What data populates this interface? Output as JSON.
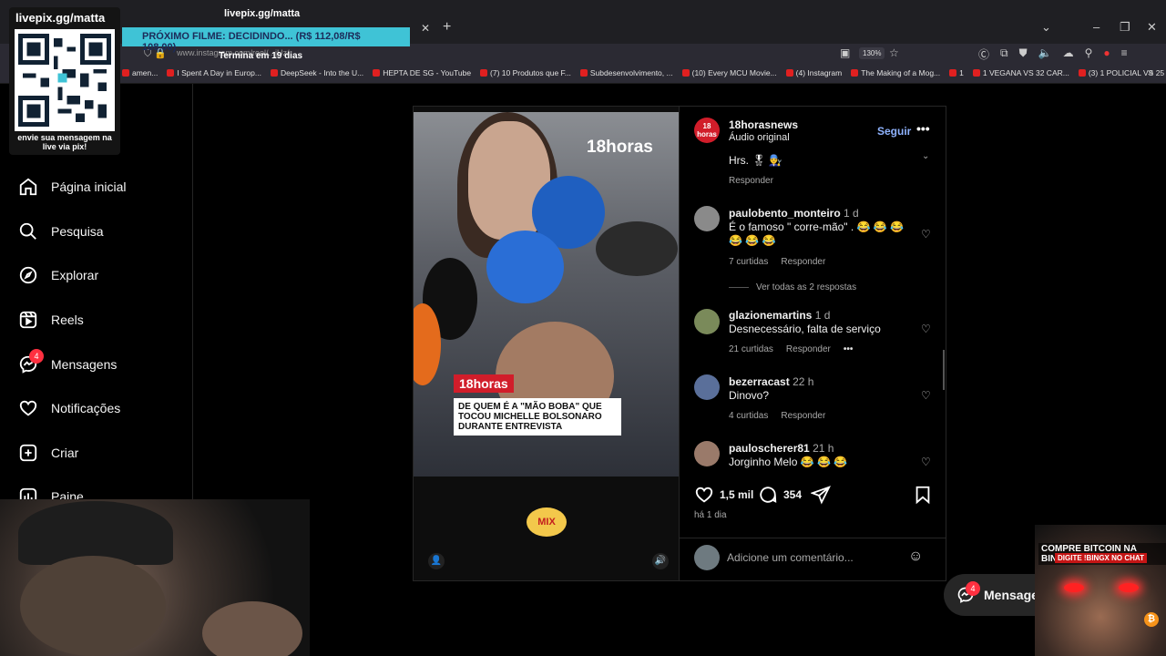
{
  "browser": {
    "tab_title": "Termina em 19 dias",
    "url": "www.instagram.com/reel/...jUz/",
    "zoom": "130%",
    "bookmarks": [
      "amen...",
      "I Spent A Day in Europ...",
      "DeepSeek - Into the U...",
      "HEPTA DE SG - YouTube",
      "(7) 10 Produtos que F...",
      "Subdesenvolvimento, ...",
      "(10) Every MCU Movie...",
      "(4) Instagram",
      "The Making of a Mog...",
      "1",
      "1 VEGANA VS 32 CAR...",
      "(3) 1 POLICIAL VS 25 E..."
    ]
  },
  "overlay": {
    "pix_handle": "livepix.gg/matta",
    "pix_handle_top": "livepix.gg/matta",
    "pix_caption": "envie sua mensagem na live via pix!",
    "banner": "PRÓXIMO FILME: DECIDINDO... (R$ 112,08/R$ 108,00)",
    "ad_line1": "COMPRE BITCOIN NA BINGX.",
    "ad_line2": "DIGITE !BINGX NO CHAT"
  },
  "sidebar": {
    "items": [
      {
        "label": "Página inicial",
        "icon": "home-icon"
      },
      {
        "label": "Pesquisa",
        "icon": "search-icon"
      },
      {
        "label": "Explorar",
        "icon": "compass-icon"
      },
      {
        "label": "Reels",
        "icon": "reels-icon"
      },
      {
        "label": "Mensagens",
        "icon": "messenger-icon",
        "badge": "4"
      },
      {
        "label": "Notificações",
        "icon": "heart-icon"
      },
      {
        "label": "Criar",
        "icon": "plus-square-icon"
      },
      {
        "label": "Paine",
        "icon": "chart-icon"
      }
    ]
  },
  "video": {
    "watermark": "18horas",
    "logo": "18horas",
    "headline": "DE QUEM É A \"MÃO BOBA\" QUE TOCOU MICHELLE BOLSONARO DURANTE ENTREVISTA",
    "sponsor": "MIX"
  },
  "post": {
    "username": "18horasnews",
    "audio": "Áudio original",
    "follow": "Seguir",
    "avatar_text": "18 horas",
    "likes": "1,5 mil",
    "comments_count": "354",
    "time": "há 1 dia",
    "add_comment_placeholder": "Adicione um comentário..."
  },
  "comments": {
    "partial": {
      "text": "Hrs. 🎖 👨‍🔧",
      "reply": "Responder"
    },
    "items": [
      {
        "user": "paulobento_monteiro",
        "time": "1 d",
        "text": "É o famoso \" corre-mão\" . 😂 😂 😂 😂 😂 😂",
        "likes": "7 curtidas",
        "reply": "Responder"
      },
      {
        "user": "glazionemartins",
        "time": "1 d",
        "text": "Desnecessário, falta de serviço",
        "likes": "21 curtidas",
        "reply": "Responder"
      },
      {
        "user": "bezerracast",
        "time": "22 h",
        "text": "Dinovo?",
        "likes": "4 curtidas",
        "reply": "Responder"
      },
      {
        "user": "pauloscherer81",
        "time": "21 h",
        "text": "Jorginho Melo 😂 😂 😂"
      }
    ],
    "view_replies": "Ver todas as 2 respostas"
  },
  "float": {
    "messages_label": "Mensage",
    "badge": "4"
  },
  "colors": {
    "accent_link": "#8fb3ff",
    "badge": "#ff3040",
    "banner_bg": "#3fc3d6",
    "brand_red": "#d11d2a"
  }
}
